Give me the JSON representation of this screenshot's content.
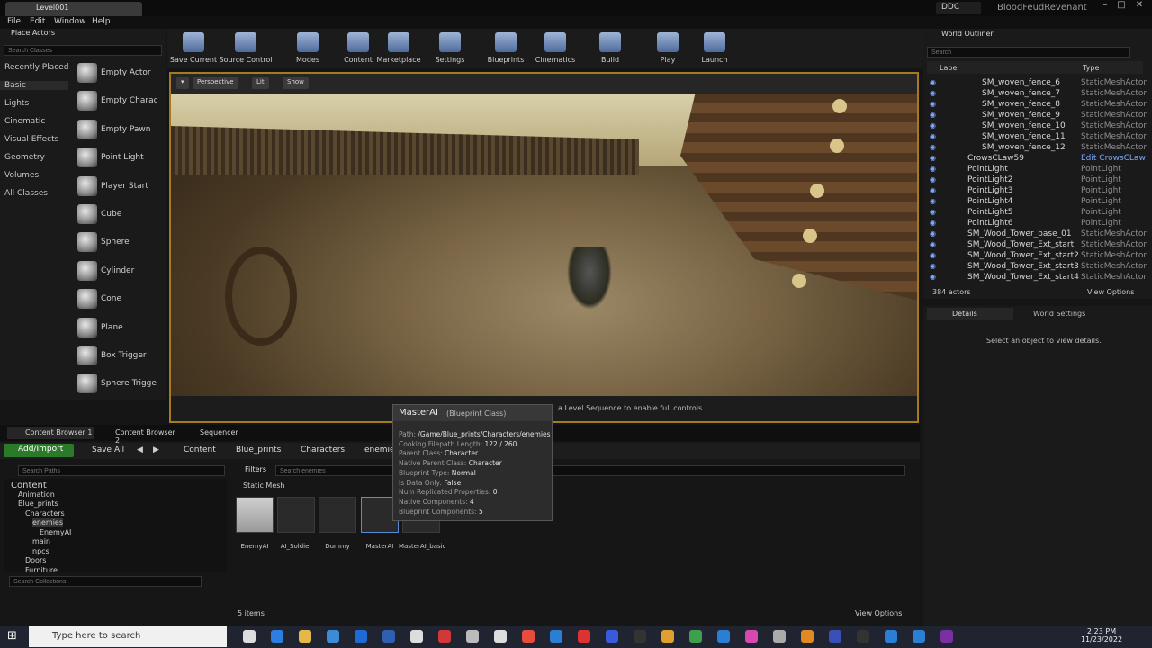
{
  "title_bar": {
    "level_tab": "Level001",
    "ddc": "DDC",
    "project": "BloodFeudRevenant"
  },
  "menu": [
    "File",
    "Edit",
    "Window",
    "Help"
  ],
  "place_actors": {
    "title": "Place Actors",
    "search_placeholder": "Search Classes",
    "categories": [
      "Recently Placed",
      "Basic",
      "Lights",
      "Cinematic",
      "Visual Effects",
      "Geometry",
      "Volumes",
      "All Classes"
    ],
    "actors": [
      "Empty Actor",
      "Empty Charac",
      "Empty Pawn",
      "Point Light",
      "Player Start",
      "Cube",
      "Sphere",
      "Cylinder",
      "Cone",
      "Plane",
      "Box Trigger",
      "Sphere Trigge"
    ]
  },
  "toolbar": [
    "Save Current",
    "Source Control",
    "Modes",
    "Content",
    "Marketplace",
    "Settings",
    "Blueprints",
    "Cinematics",
    "Build",
    "Play",
    "Launch"
  ],
  "viewport": {
    "perspective": "Perspective",
    "lit": "Lit",
    "show": "Show",
    "seq_hint": "a Level Sequence to enable full controls."
  },
  "outliner": {
    "title": "World Outliner",
    "search_placeholder": "Search",
    "col_label": "Label",
    "col_type": "Type",
    "rows": [
      {
        "name": "SM_woven_fence_6",
        "type": "StaticMeshActor"
      },
      {
        "name": "SM_woven_fence_7",
        "type": "StaticMeshActor"
      },
      {
        "name": "SM_woven_fence_8",
        "type": "StaticMeshActor"
      },
      {
        "name": "SM_woven_fence_9",
        "type": "StaticMeshActor"
      },
      {
        "name": "SM_woven_fence_10",
        "type": "StaticMeshActor"
      },
      {
        "name": "SM_woven_fence_11",
        "type": "StaticMeshActor"
      },
      {
        "name": "SM_woven_fence_12",
        "type": "StaticMeshActor"
      },
      {
        "name": "CrowsCLaw59",
        "type": "Edit CrowsCLaw"
      },
      {
        "name": "PointLight",
        "type": "PointLight"
      },
      {
        "name": "PointLight2",
        "type": "PointLight"
      },
      {
        "name": "PointLight3",
        "type": "PointLight"
      },
      {
        "name": "PointLight4",
        "type": "PointLight"
      },
      {
        "name": "PointLight5",
        "type": "PointLight"
      },
      {
        "name": "PointLight6",
        "type": "PointLight"
      },
      {
        "name": "SM_Wood_Tower_base_01",
        "type": "StaticMeshActor"
      },
      {
        "name": "SM_Wood_Tower_Ext_start",
        "type": "StaticMeshActor"
      },
      {
        "name": "SM_Wood_Tower_Ext_start2",
        "type": "StaticMeshActor"
      },
      {
        "name": "SM_Wood_Tower_Ext_start3",
        "type": "StaticMeshActor"
      },
      {
        "name": "SM_Wood_Tower_Ext_start4",
        "type": "StaticMeshActor"
      }
    ],
    "actor_count": "384 actors",
    "view_options": "View Options"
  },
  "details": {
    "tab": "Details",
    "world_settings": "World Settings",
    "message": "Select an object to view details."
  },
  "content_browser": {
    "tabs": [
      "Content Browser 1",
      "Content Browser 2",
      "Sequencer"
    ],
    "add_import": "Add/Import",
    "save_all": "Save All",
    "breadcrumb": [
      "Content",
      "Blue_prints",
      "Characters",
      "enemies"
    ],
    "path_search_placeholder": "Search Paths",
    "filters": "Filters",
    "asset_search_placeholder": "Search enemies",
    "tree": [
      {
        "label": "Content",
        "indent": 0
      },
      {
        "label": "Animation",
        "indent": 1
      },
      {
        "label": "Blue_prints",
        "indent": 1
      },
      {
        "label": "Characters",
        "indent": 2
      },
      {
        "label": "enemies",
        "indent": 3
      },
      {
        "label": "EnemyAI",
        "indent": 4
      },
      {
        "label": "main",
        "indent": 3
      },
      {
        "label": "npcs",
        "indent": 3
      },
      {
        "label": "Doors",
        "indent": 2
      },
      {
        "label": "Furniture",
        "indent": 2
      }
    ],
    "collections_search_placeholder": "Search Collections",
    "filter_label": "Static Mesh",
    "assets": [
      "EnemyAI",
      "AI_Soldier",
      "Dummy",
      "MasterAI",
      "MasterAI_basic"
    ],
    "items_count": "5 items",
    "view_options": "View Options"
  },
  "tooltip": {
    "title": "MasterAI",
    "subtitle": "(Blueprint Class)",
    "rows": [
      {
        "k": "Path:",
        "v": "/Game/Blue_prints/Characters/enemies"
      },
      {
        "k": "Cooking Filepath Length:",
        "v": "122 / 260"
      },
      {
        "k": "Parent Class:",
        "v": "Character"
      },
      {
        "k": "Native Parent Class:",
        "v": "Character"
      },
      {
        "k": "Blueprint Type:",
        "v": "Normal"
      },
      {
        "k": "Is Data Only:",
        "v": "False"
      },
      {
        "k": "Num Replicated Properties:",
        "v": "0"
      },
      {
        "k": "Native Components:",
        "v": "4"
      },
      {
        "k": "Blueprint Components:",
        "v": "5"
      }
    ]
  },
  "taskbar": {
    "search_placeholder": "Type here to search",
    "time": "2:23 PM",
    "date": "11/23/2022"
  },
  "colors": {
    "accent_orange": "#a57a20",
    "add_green": "#2b7a2a",
    "outliner_eye": "#7aa7ff"
  }
}
